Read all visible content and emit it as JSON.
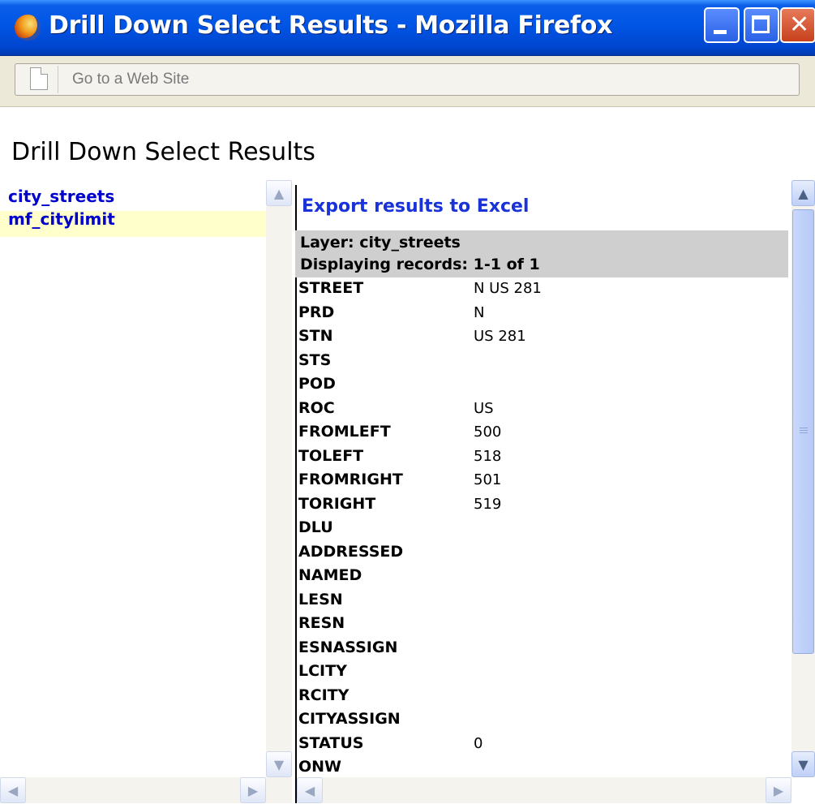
{
  "window": {
    "title": "Drill Down Select Results - Mozilla Firefox"
  },
  "addressbar": {
    "placeholder": "Go to a Web Site"
  },
  "page": {
    "title": "Drill Down Select Results"
  },
  "layers": [
    {
      "label": "city_streets",
      "selected": false
    },
    {
      "label": "mf_citylimit",
      "selected": true
    }
  ],
  "results": {
    "export_label": "Export results to Excel",
    "layer_line": "Layer: city_streets",
    "records_line": "Displaying records: 1-1 of 1",
    "fields": [
      {
        "name": "STREET",
        "value": "N US 281"
      },
      {
        "name": "PRD",
        "value": "N"
      },
      {
        "name": "STN",
        "value": "US 281"
      },
      {
        "name": "STS",
        "value": ""
      },
      {
        "name": "POD",
        "value": ""
      },
      {
        "name": "ROC",
        "value": "US"
      },
      {
        "name": "FROMLEFT",
        "value": "500"
      },
      {
        "name": "TOLEFT",
        "value": "518"
      },
      {
        "name": "FROMRIGHT",
        "value": "501"
      },
      {
        "name": "TORIGHT",
        "value": "519"
      },
      {
        "name": "DLU",
        "value": ""
      },
      {
        "name": "ADDRESSED",
        "value": ""
      },
      {
        "name": "NAMED",
        "value": ""
      },
      {
        "name": "LESN",
        "value": ""
      },
      {
        "name": "RESN",
        "value": ""
      },
      {
        "name": "ESNASSIGN",
        "value": ""
      },
      {
        "name": "LCITY",
        "value": ""
      },
      {
        "name": "RCITY",
        "value": ""
      },
      {
        "name": "CITYASSIGN",
        "value": ""
      },
      {
        "name": "STATUS",
        "value": "0"
      },
      {
        "name": "ONW",
        "value": ""
      }
    ]
  },
  "icons": {
    "up": "▲",
    "down": "▼",
    "left": "◀",
    "right": "▶"
  }
}
